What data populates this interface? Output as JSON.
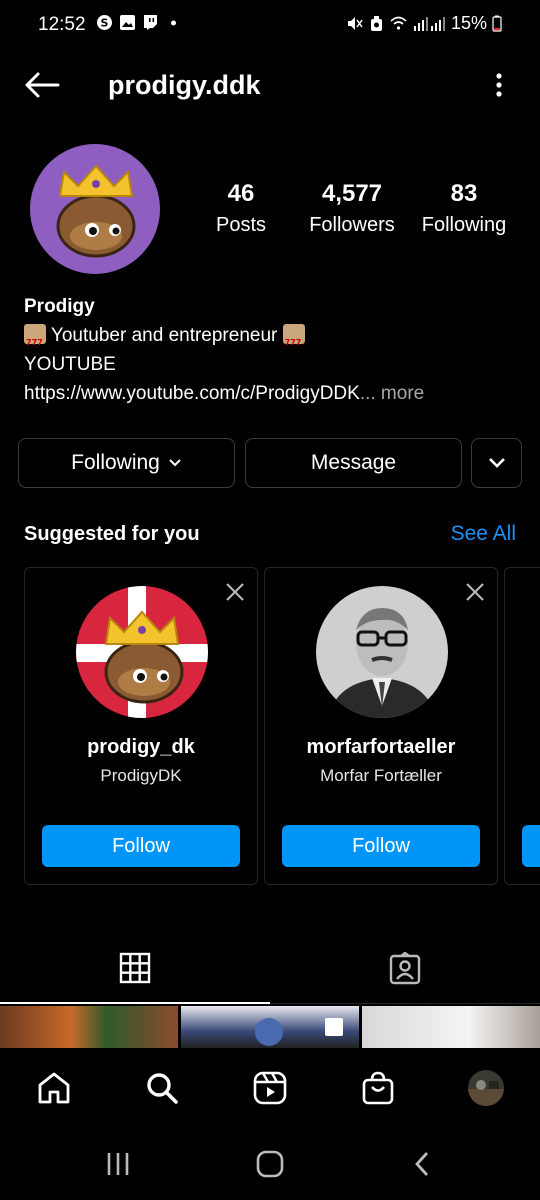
{
  "status_bar": {
    "time": "12:52",
    "battery": "15%",
    "left_icons": [
      "skype-icon",
      "gallery-icon",
      "twitch-icon",
      "dot-icon"
    ],
    "right_icons": [
      "mute-icon",
      "alarm-icon",
      "wifi-icon",
      "signal-icon",
      "battery-icon"
    ]
  },
  "header": {
    "username": "prodigy.ddk"
  },
  "profile": {
    "stats": [
      {
        "value": "46",
        "label": "Posts"
      },
      {
        "value": "4,577",
        "label": "Followers"
      },
      {
        "value": "83",
        "label": "Following"
      }
    ],
    "name": "Prodigy",
    "bio_line1": " Youtuber and entrepreneur ",
    "bio_line2": "YOUTUBE",
    "bio_link": "https://www.youtube.com/c/ProdigyDDK",
    "bio_more": "... more"
  },
  "actions": {
    "following_label": "Following",
    "message_label": "Message"
  },
  "suggested": {
    "title": "Suggested for you",
    "see_all": "See All",
    "cards": [
      {
        "username": "prodigy_dk",
        "fullname": "ProdigyDK",
        "follow_label": "Follow"
      },
      {
        "username": "morfarfortaeller",
        "fullname": "Morfar Fortæller",
        "follow_label": "Follow"
      }
    ]
  },
  "tabs": [
    "grid-tab",
    "tagged-tab"
  ],
  "bottom_nav": [
    "home",
    "search",
    "reels",
    "shop",
    "profile"
  ],
  "colors": {
    "accent_blue": "#0095f6",
    "link_blue": "#1b92f5",
    "avatar_purple": "#8e5fc0",
    "border": "#3c3c3c"
  }
}
